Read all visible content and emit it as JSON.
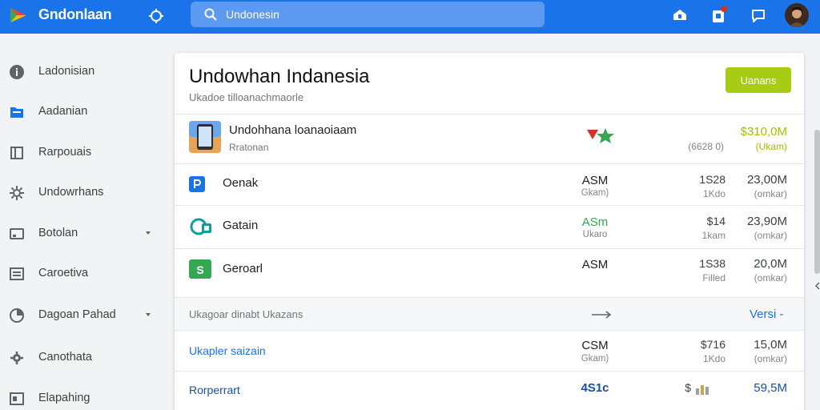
{
  "app": {
    "title": "Gndonlaan",
    "search_value": "Undonesin"
  },
  "colors": {
    "topbar": "#1a73e8",
    "accent_button": "#a8cc15",
    "price_green": "#a0c000",
    "asm_green": "#34a853",
    "link_blue": "#1a73e8"
  },
  "sidebar": {
    "items": [
      {
        "label": "Ladonisian",
        "icon": "info-circle-icon"
      },
      {
        "label": "Aadanian",
        "icon": "folder-icon"
      },
      {
        "label": "Rarpouais",
        "icon": "book-icon"
      },
      {
        "label": "Undowrhans",
        "icon": "settings-cog-icon"
      },
      {
        "label": "Botolan",
        "icon": "card-icon"
      },
      {
        "label": "Caroetiva",
        "icon": "list-icon"
      },
      {
        "label": "Dagoan Pahad",
        "icon": "chart-pie-icon"
      },
      {
        "label": "Canothata",
        "icon": "gear-icon"
      },
      {
        "label": "Elapahing",
        "icon": "document-icon"
      }
    ]
  },
  "main": {
    "title": "Undowhan Indanesia",
    "subtitle": "Ukadoe tilloanachmaorle",
    "action_button": "Uanans",
    "featured": {
      "name": "Undohhana loanaoiaam",
      "sub": "Rratonan",
      "metric_sub": "(6628 0)",
      "price": "$310,0M",
      "price_sub": "(Ukam)"
    },
    "rows": [
      {
        "name": "Oenak",
        "c1": "ASM",
        "c1s": "Gkam)",
        "c2": "1S28",
        "c2s": "1Kdo",
        "c3": "23,00M",
        "c3s": "(omkar)"
      },
      {
        "name": "Gatain",
        "c1": "ASm",
        "c1s": "Ukaro",
        "c2": "$14",
        "c2s": "1kam",
        "c3": "23,90M",
        "c3s": "(omkar)"
      },
      {
        "name": "Geroarl",
        "c1": "ASM",
        "c1s": "",
        "c2": "1S38",
        "c2s": "Filled",
        "c3": "20,0M",
        "c3s": "(omkar)"
      }
    ],
    "section": {
      "label": "Ukagoar dinabt Ukazans",
      "link": "Versi -"
    },
    "links": [
      {
        "name": "Ukapler saizain",
        "c1": "CSM",
        "c1s": "Gkam)",
        "c2": "$716",
        "c2s": "1Kdo",
        "c3": "15,0M",
        "c3s": "(omkar)"
      },
      {
        "name": "Rorperrart",
        "c1": "4S1c",
        "c2": "$",
        "c3": "59,5M"
      }
    ]
  }
}
